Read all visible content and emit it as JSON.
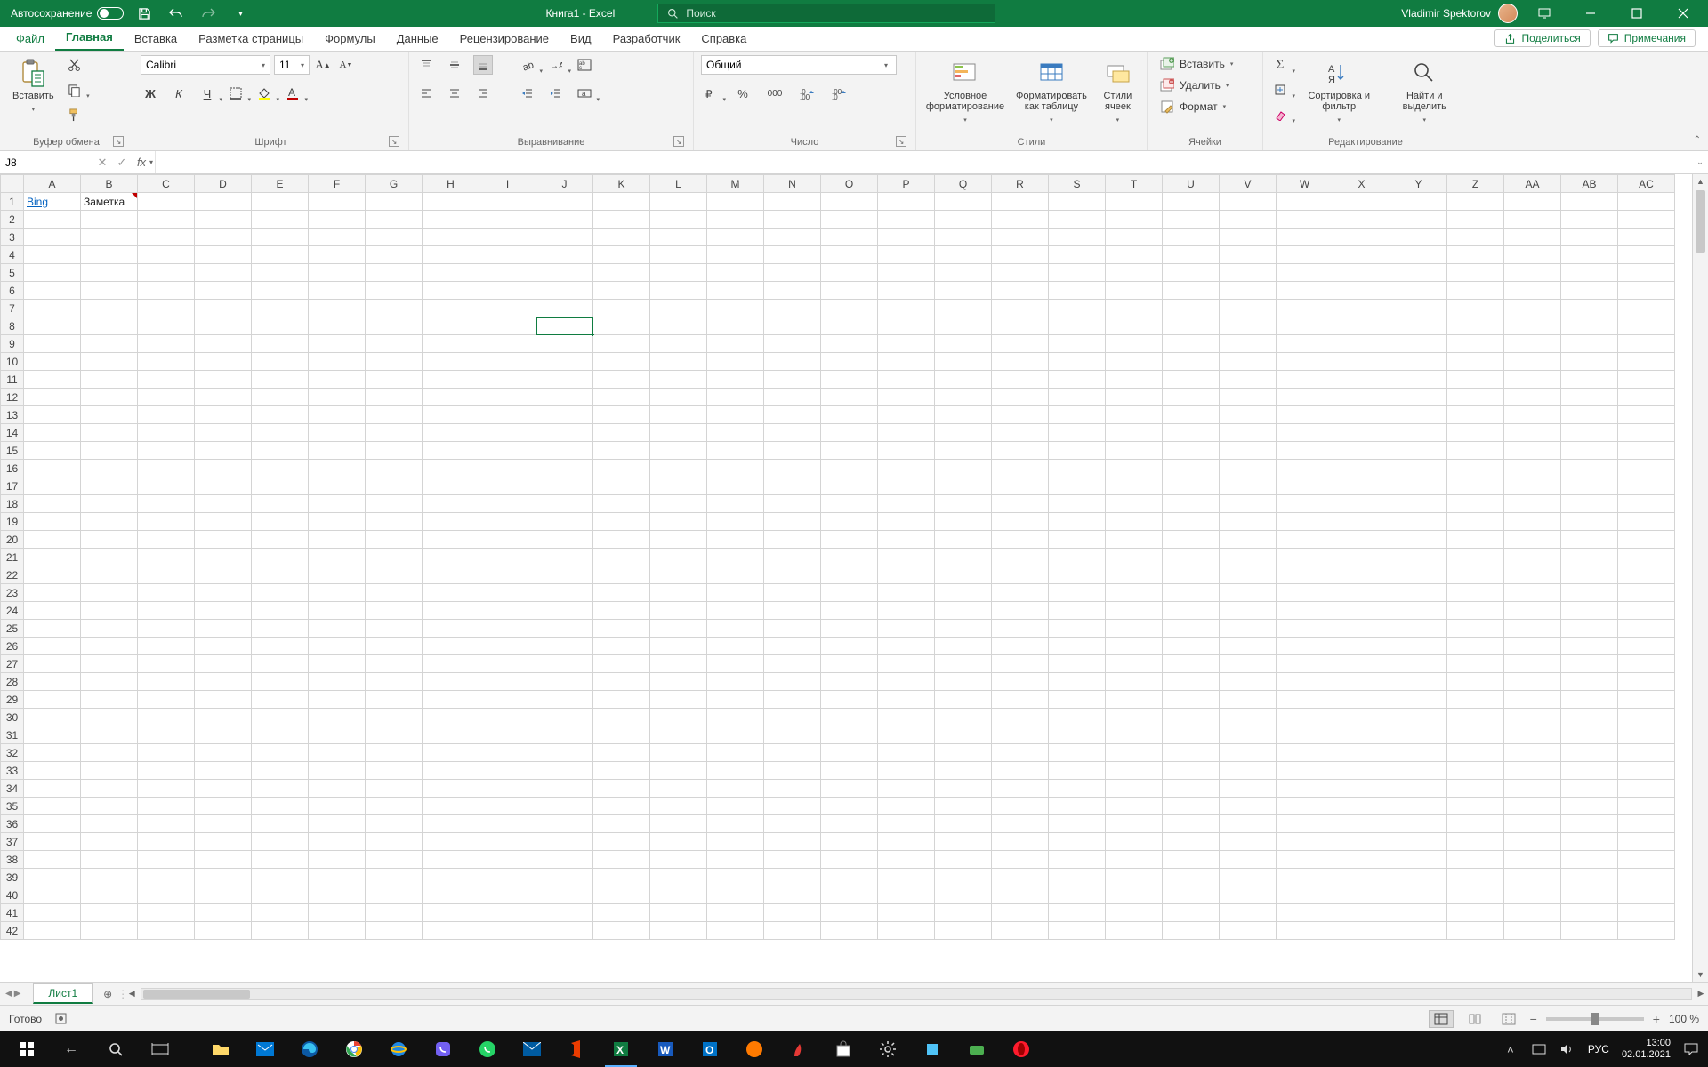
{
  "title": {
    "autosave": "Автосохранение",
    "doc": "Книга1  -  Excel",
    "search_placeholder": "Поиск",
    "user": "Vladimir Spektorov"
  },
  "tabs": {
    "file": "Файл",
    "home": "Главная",
    "insert": "Вставка",
    "layout": "Разметка страницы",
    "formulas": "Формулы",
    "data": "Данные",
    "review": "Рецензирование",
    "view": "Вид",
    "developer": "Разработчик",
    "help": "Справка"
  },
  "share": {
    "share": "Поделиться",
    "comments": "Примечания"
  },
  "groups": {
    "clipboard": {
      "label": "Буфер обмена",
      "paste": "Вставить"
    },
    "font": {
      "label": "Шрифт",
      "name": "Calibri",
      "size": "11"
    },
    "align": {
      "label": "Выравнивание"
    },
    "number": {
      "label": "Число",
      "format": "Общий"
    },
    "styles": {
      "label": "Стили",
      "cond": "Условное форматирование",
      "table": "Форматировать как таблицу",
      "cell": "Стили ячеек"
    },
    "cells": {
      "label": "Ячейки",
      "insert": "Вставить",
      "delete": "Удалить",
      "format": "Формат"
    },
    "editing": {
      "label": "Редактирование",
      "sort": "Сортировка и фильтр",
      "find": "Найти и выделить"
    }
  },
  "namebox": "J8",
  "columns": [
    "A",
    "B",
    "C",
    "D",
    "E",
    "F",
    "G",
    "H",
    "I",
    "J",
    "K",
    "L",
    "M",
    "N",
    "O",
    "P",
    "Q",
    "R",
    "S",
    "T",
    "U",
    "V",
    "W",
    "X",
    "Y",
    "Z",
    "AA",
    "AB",
    "AC"
  ],
  "rows": 42,
  "cells": {
    "A1": "Bing",
    "B1": "Заметка"
  },
  "selected": "J8",
  "sheet_tab": "Лист1",
  "status": {
    "ready": "Готово",
    "zoom": "100 %"
  },
  "taskbar": {
    "lang": "РУС",
    "time": "13:00",
    "date": "02.01.2021"
  }
}
